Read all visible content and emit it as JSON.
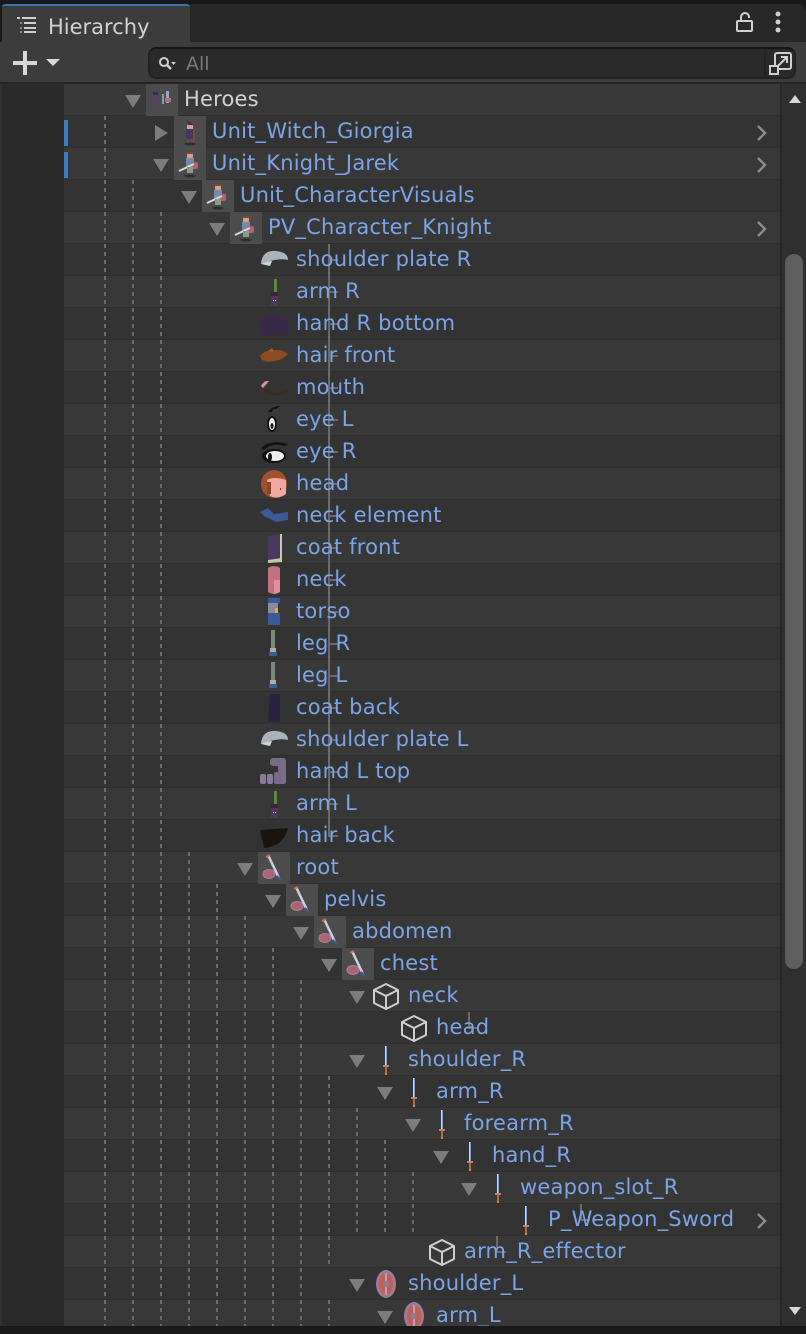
{
  "window": {
    "tab_label": "Hierarchy",
    "tab_icon": "hierarchy-list-icon",
    "lock_icon": "lock-open-icon",
    "menu_icon": "more-vertical-icon"
  },
  "toolbar": {
    "add_icon": "plus-icon",
    "add_dropdown_icon": "caret-down-icon",
    "search_placeholder": "All",
    "search_value": "",
    "search_icon": "search-filter-icon",
    "scene_button_icon": "open-scene-window-icon"
  },
  "colors": {
    "prefab_text": "#7ba4e8",
    "plain_text": "#d2d2d2",
    "prefab_marker": "#3a7ec0",
    "accent_tab": "#3a72b0"
  },
  "tree": [
    {
      "label": "Heroes",
      "depth": 0,
      "fold": "open",
      "icon": "heroes-group-icon",
      "style": "plain"
    },
    {
      "label": "Unit_Witch_Giorgia",
      "depth": 1,
      "fold": "closed",
      "icon": "witch-sprite-icon",
      "prefab_marker": true,
      "chevron": true
    },
    {
      "label": "Unit_Knight_Jarek",
      "depth": 1,
      "fold": "open",
      "icon": "knight-sprite-icon",
      "prefab_marker": true,
      "chevron": true
    },
    {
      "label": "Unit_CharacterVisuals",
      "depth": 2,
      "fold": "open",
      "icon": "knight-sprite-icon"
    },
    {
      "label": "PV_Character_Knight",
      "depth": 3,
      "fold": "open",
      "icon": "knight-sprite-icon",
      "chevron": true
    },
    {
      "label": "shoulder plate R",
      "depth": 4,
      "icon": "shoulder-plate-sprite-icon",
      "leaf": true
    },
    {
      "label": "arm R",
      "depth": 4,
      "icon": "arm-sprite-icon",
      "leaf": true
    },
    {
      "label": "hand R bottom",
      "depth": 4,
      "icon": "hand-sprite-icon",
      "leaf": true
    },
    {
      "label": "hair front",
      "depth": 4,
      "icon": "hair-front-sprite-icon",
      "leaf": true
    },
    {
      "label": "mouth",
      "depth": 4,
      "icon": "mouth-sprite-icon",
      "leaf": true
    },
    {
      "label": "eye L",
      "depth": 4,
      "icon": "eye-l-sprite-icon",
      "leaf": true
    },
    {
      "label": "eye R",
      "depth": 4,
      "icon": "eye-r-sprite-icon",
      "leaf": true
    },
    {
      "label": "head",
      "depth": 4,
      "icon": "head-sprite-icon",
      "leaf": true
    },
    {
      "label": "neck element",
      "depth": 4,
      "icon": "scarf-sprite-icon",
      "leaf": true
    },
    {
      "label": "coat front",
      "depth": 4,
      "icon": "coat-front-sprite-icon",
      "leaf": true
    },
    {
      "label": "neck",
      "depth": 4,
      "icon": "neck-sprite-icon",
      "leaf": true
    },
    {
      "label": "torso",
      "depth": 4,
      "icon": "torso-sprite-icon",
      "leaf": true
    },
    {
      "label": "leg R",
      "depth": 4,
      "icon": "leg-sprite-icon",
      "leaf": true
    },
    {
      "label": "leg L",
      "depth": 4,
      "icon": "leg-sprite-icon",
      "leaf": true
    },
    {
      "label": "coat back",
      "depth": 4,
      "icon": "coat-back-sprite-icon",
      "leaf": true
    },
    {
      "label": "shoulder plate L",
      "depth": 4,
      "icon": "shoulder-plate-sprite-icon",
      "leaf": true
    },
    {
      "label": "hand L top",
      "depth": 4,
      "icon": "fist-sprite-icon",
      "leaf": true
    },
    {
      "label": "arm L",
      "depth": 4,
      "icon": "arm-sprite-icon",
      "leaf": true
    },
    {
      "label": "hair back",
      "depth": 4,
      "icon": "hair-back-sprite-icon",
      "leaf": true,
      "last": true
    },
    {
      "label": "root",
      "depth": 4,
      "fold": "open",
      "icon": "sword-shield-icon"
    },
    {
      "label": "pelvis",
      "depth": 5,
      "fold": "open",
      "icon": "sword-shield-icon"
    },
    {
      "label": "abdomen",
      "depth": 6,
      "fold": "open",
      "icon": "sword-shield-icon"
    },
    {
      "label": "chest",
      "depth": 7,
      "fold": "open",
      "icon": "sword-shield-icon"
    },
    {
      "label": "neck",
      "depth": 8,
      "fold": "open",
      "icon": "gameobject-cube-icon"
    },
    {
      "label": "head",
      "depth": 9,
      "icon": "gameobject-cube-icon",
      "leaf": true,
      "last": true
    },
    {
      "label": "shoulder_R",
      "depth": 8,
      "fold": "open",
      "icon": "sword-icon"
    },
    {
      "label": "arm_R",
      "depth": 9,
      "fold": "open",
      "icon": "sword-icon"
    },
    {
      "label": "forearm_R",
      "depth": 10,
      "fold": "open",
      "icon": "sword-icon"
    },
    {
      "label": "hand_R",
      "depth": 11,
      "fold": "open",
      "icon": "sword-icon"
    },
    {
      "label": "weapon_slot_R",
      "depth": 12,
      "fold": "open",
      "icon": "sword-icon"
    },
    {
      "label": "P_Weapon_Sword",
      "depth": 13,
      "icon": "sword-icon",
      "leaf": true,
      "last": true,
      "chevron": true
    },
    {
      "label": "arm_R_effector",
      "depth": 10,
      "icon": "gameobject-cube-icon",
      "leaf": true,
      "last": true
    },
    {
      "label": "shoulder_L",
      "depth": 8,
      "fold": "open",
      "icon": "shield-icon"
    },
    {
      "label": "arm_L",
      "depth": 9,
      "fold": "open",
      "icon": "shield-icon"
    }
  ],
  "scrollbar": {
    "up_icon": "scroll-up-arrow-icon",
    "down_icon": "scroll-down-arrow-icon",
    "position_fraction": 0.14,
    "visible_fraction": 0.58
  }
}
